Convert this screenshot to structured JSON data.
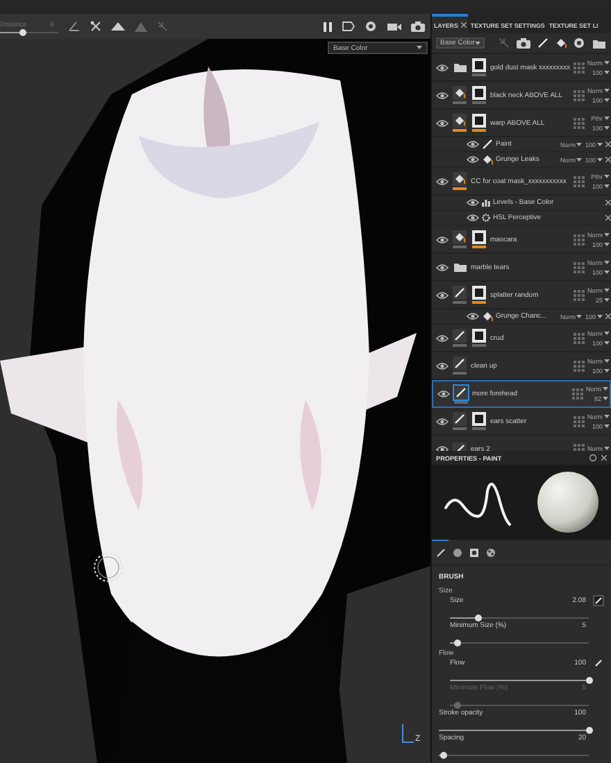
{
  "viewport": {
    "distance": {
      "label": "Distance",
      "value": "8",
      "level": 0.4
    },
    "channel": "Base Color",
    "gizmo_label": "Z"
  },
  "layers_panel": {
    "tabs": [
      {
        "label": "LAYERS",
        "selected": true,
        "closable": true
      },
      {
        "label": "TEXTURE SET SETTINGS",
        "selected": false,
        "closable": false
      },
      {
        "label": "TEXTURE SET LI",
        "selected": false,
        "closable": false
      }
    ],
    "channel": "Base Color",
    "layers": [
      {
        "name": "gold dust mask xxxxxxxxx",
        "kind": "folder",
        "mask": true,
        "mask_active": false,
        "blend": "Norm",
        "opacity": "100",
        "selected": false
      },
      {
        "name": "black neck ABOVE ALL",
        "kind": "fill",
        "mask": true,
        "content_active": false,
        "mask_active": false,
        "blend": "Norm",
        "opacity": "100",
        "selected": false
      },
      {
        "name": "warp ABOVE ALL",
        "kind": "fill",
        "mask": true,
        "content_active": true,
        "mask_active": true,
        "blend": "Pthr",
        "opacity": "100",
        "selected": false,
        "children": [
          {
            "name": "Paint",
            "kind": "paint",
            "blend": "Norm",
            "opacity": "100"
          },
          {
            "name": "Grunge Leaks",
            "kind": "fill",
            "blend": "Norm",
            "opacity": "100"
          }
        ]
      },
      {
        "name": "CC for coat mask_xxxxxxxxxxx",
        "kind": "fill",
        "mask": false,
        "content_active": true,
        "blend": "Pthr",
        "opacity": "100",
        "selected": false,
        "children": [
          {
            "name": "Levels - Base Color",
            "kind": "levels"
          },
          {
            "name": "HSL Perceptive",
            "kind": "hsl"
          }
        ]
      },
      {
        "name": "mascara",
        "kind": "fill",
        "mask": true,
        "content_active": false,
        "mask_active": true,
        "blend": "Norm",
        "opacity": "100",
        "selected": false
      },
      {
        "name": "marble tears",
        "kind": "folder",
        "mask": false,
        "blend": "Norm",
        "opacity": "100",
        "selected": false
      },
      {
        "name": "splatter random",
        "kind": "paint",
        "mask": true,
        "content_active": false,
        "mask_active": true,
        "blend": "Norm",
        "opacity": "25",
        "selected": false,
        "children": [
          {
            "name": "Grunge Chanc...",
            "kind": "fill",
            "blend": "Norm",
            "opacity": "100"
          }
        ]
      },
      {
        "name": "crud",
        "kind": "paint",
        "mask": true,
        "content_active": false,
        "mask_active": false,
        "blend": "Norm",
        "opacity": "100",
        "selected": false
      },
      {
        "name": "clean up",
        "kind": "paint",
        "mask": false,
        "content_active": false,
        "blend": "Norm",
        "opacity": "100",
        "selected": false
      },
      {
        "name": "more forehead",
        "kind": "paint",
        "mask": false,
        "content_active": false,
        "blend": "Norm",
        "opacity": "82",
        "selected": true
      },
      {
        "name": "ears scatter",
        "kind": "paint",
        "mask": true,
        "content_active": false,
        "mask_active": false,
        "blend": "Norm",
        "opacity": "100",
        "selected": false
      },
      {
        "name": "ears 2",
        "kind": "paint",
        "mask": false,
        "blend": "Norm",
        "selected": false
      }
    ]
  },
  "properties": {
    "title": "PROPERTIES - PAINT",
    "tabs": [
      {
        "kind": "brush",
        "selected": true
      },
      {
        "kind": "material",
        "selected": false
      },
      {
        "kind": "stencil",
        "selected": false
      },
      {
        "kind": "particles",
        "selected": false
      }
    ],
    "section": "BRUSH",
    "groups": [
      {
        "title": "Size",
        "sliders": [
          {
            "label": "Size",
            "value": "2.08",
            "level": 0.2,
            "disabled": false,
            "pressure": true,
            "pressure_boxed": true
          },
          {
            "label": "Minimum Size (%)",
            "value": "5",
            "level": 0.05,
            "disabled": false
          }
        ]
      },
      {
        "title": "Flow",
        "sliders": [
          {
            "label": "Flow",
            "value": "100",
            "level": 1,
            "disabled": false,
            "pressure": true,
            "pressure_boxed": false
          },
          {
            "label": "Minimum Flow (%)",
            "value": "5",
            "level": 0.05,
            "disabled": true
          }
        ]
      }
    ],
    "sliders": [
      {
        "label": "Stroke opacity",
        "value": "100",
        "level": 1,
        "disabled": false
      },
      {
        "label": "Spacing",
        "value": "20",
        "level": 0.03,
        "disabled": false
      }
    ]
  }
}
